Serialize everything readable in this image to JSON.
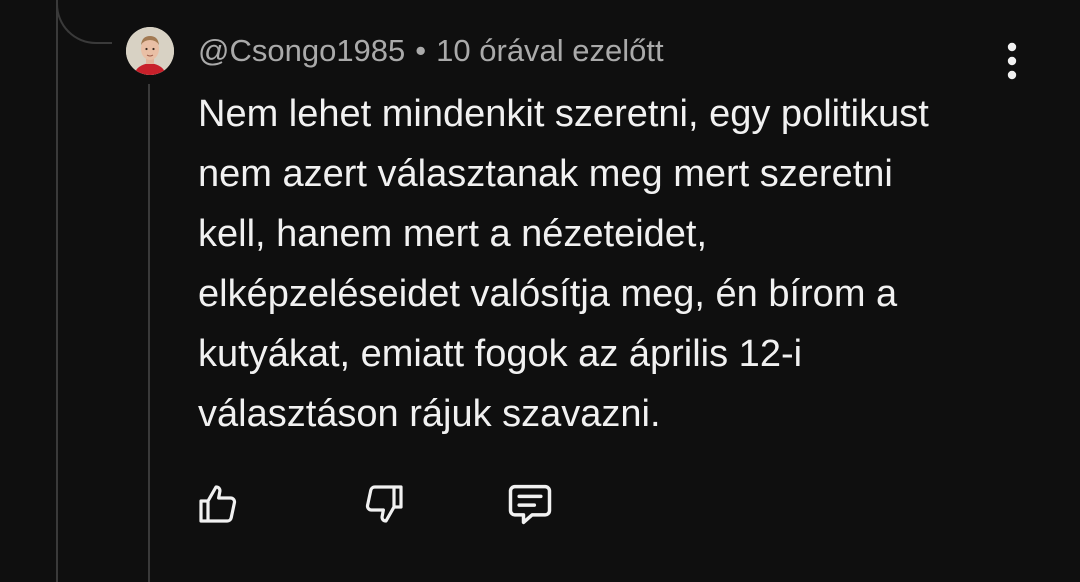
{
  "comment": {
    "author": "@Csongo1985",
    "separator": "•",
    "timestamp": "10 órával ezelőtt",
    "text_lines": [
      "Nem lehet mindenkit szeretni, egy politikust",
      "nem azert választanak meg mert szeretni",
      "kell, hanem mert a nézeteidet,",
      "elképzeléseidet valósítja meg, én bírom a",
      "kutyákat, emiatt fogok az április 12-i",
      "választáson rájuk szavazni."
    ]
  },
  "icons": {
    "avatar": "user-avatar",
    "menu": "more-vert-icon",
    "like": "thumbs-up-icon",
    "dislike": "thumbs-down-icon",
    "reply": "reply-comment-icon"
  },
  "colors": {
    "background": "#0f0f0f",
    "text_primary": "#f1f1f1",
    "text_secondary": "#aaaaaa",
    "thread_line": "#3a3a3a"
  }
}
